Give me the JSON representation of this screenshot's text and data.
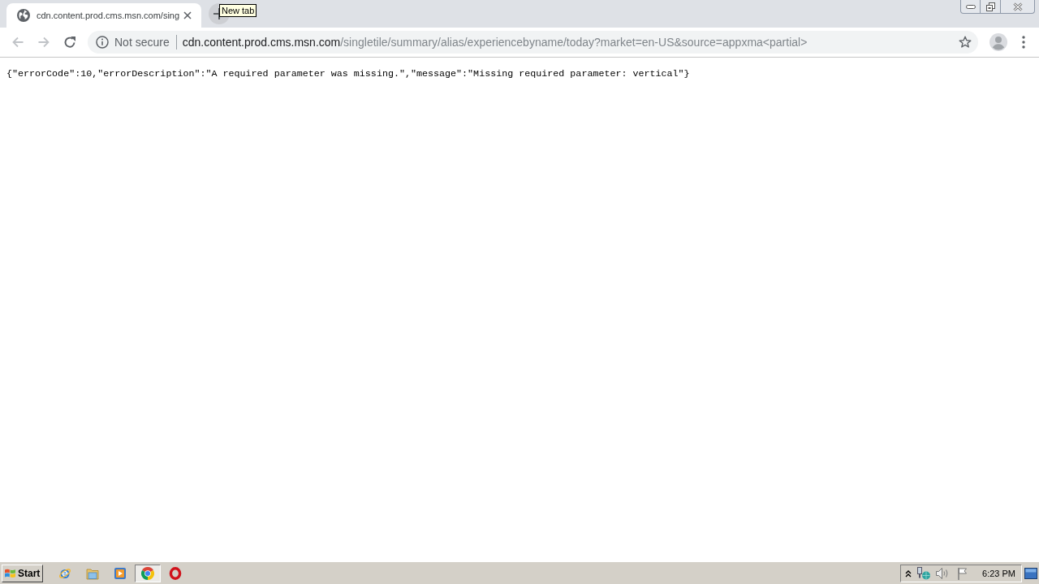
{
  "browser": {
    "tabs": [
      {
        "title": "cdn.content.prod.cms.msn.com/sing",
        "selected": true
      }
    ],
    "new_tab_tooltip": "New tab",
    "nav_buttons": [
      {
        "kind": "back",
        "disabled": true
      },
      {
        "kind": "forward",
        "disabled": true
      },
      {
        "kind": "reload",
        "disabled": false
      }
    ],
    "address_bar": {
      "security_label": "Not secure",
      "host": "cdn.content.prod.cms.msn.com",
      "path": "/singletile/summary/alias/experiencebyname/today?market=en-US&source=appxma<partial>"
    }
  },
  "page": {
    "text": "{\"errorCode\":10,\"errorDescription\":\"A required parameter was missing.\",\"message\":\"Missing required parameter: vertical\"}"
  },
  "taskbar": {
    "start_label": "Start",
    "apps": [
      {
        "kind": "ie",
        "selected": false
      },
      {
        "kind": "explorer",
        "selected": false
      },
      {
        "kind": "media",
        "selected": false
      },
      {
        "kind": "chrome",
        "selected": true
      },
      {
        "kind": "opera",
        "selected": false
      }
    ],
    "clock": "6:23 PM"
  }
}
